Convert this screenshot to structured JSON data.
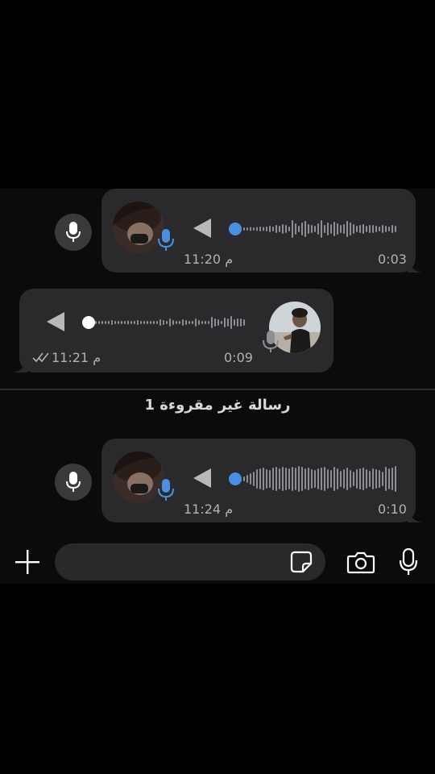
{
  "messages": [
    {
      "direction": "incoming",
      "time": "11:20 م",
      "duration": "0:03",
      "avatar": "sender-avatar"
    },
    {
      "direction": "outgoing",
      "time": "11:21 م",
      "duration": "0:09",
      "avatar": "self-avatar",
      "receipt": "double-check-icon"
    },
    {
      "direction": "incoming",
      "time": "11:24 م",
      "duration": "0:10",
      "avatar": "sender-avatar"
    }
  ],
  "unread_banner": "1 رسالة غير مقروءة",
  "input": {
    "placeholder": ""
  },
  "icons": {
    "add": "plus-icon",
    "sticker": "sticker-icon",
    "camera": "camera-icon",
    "mic": "microphone-icon",
    "play": "play-icon"
  },
  "colors": {
    "accent_blue": "#4a90e2",
    "bubble": "#2a2a2c",
    "background": "#0b0b0c"
  }
}
